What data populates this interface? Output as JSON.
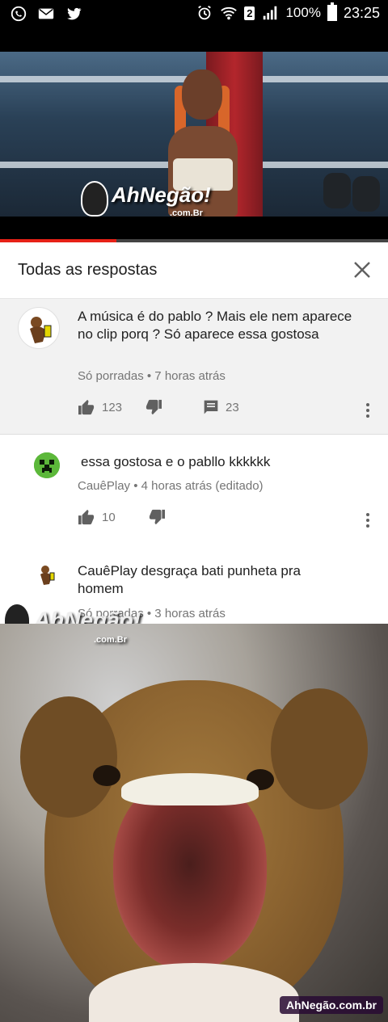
{
  "status_bar": {
    "badge": "2",
    "battery": "100%",
    "time": "23:25"
  },
  "video": {
    "watermark_brand": "AhNegão!",
    "watermark_domain": ".com.Br",
    "progress": 0.3
  },
  "panel": {
    "title": "Todas as respostas"
  },
  "comments": [
    {
      "text": "A música é do pablo ? Mais ele nem aparece no clip porq ?  Só aparece essa gostosa",
      "author_meta": "Só porradas • 7 horas atrás",
      "likes": "123",
      "replies": "23"
    },
    {
      "text": "essa gostosa e o pabllo kkkkkk",
      "author_meta": "CauêPlay • 4 horas atrás (editado)",
      "likes": "10"
    },
    {
      "text": "CauêPlay desgraça bati punheta pra homem",
      "author_meta": "Só porradas • 3 horas atrás"
    }
  ],
  "photo": {
    "watermark_brand": "AhNegão!",
    "watermark_domain": ".com.Br",
    "site_badge": "AhNegão.com.br"
  }
}
